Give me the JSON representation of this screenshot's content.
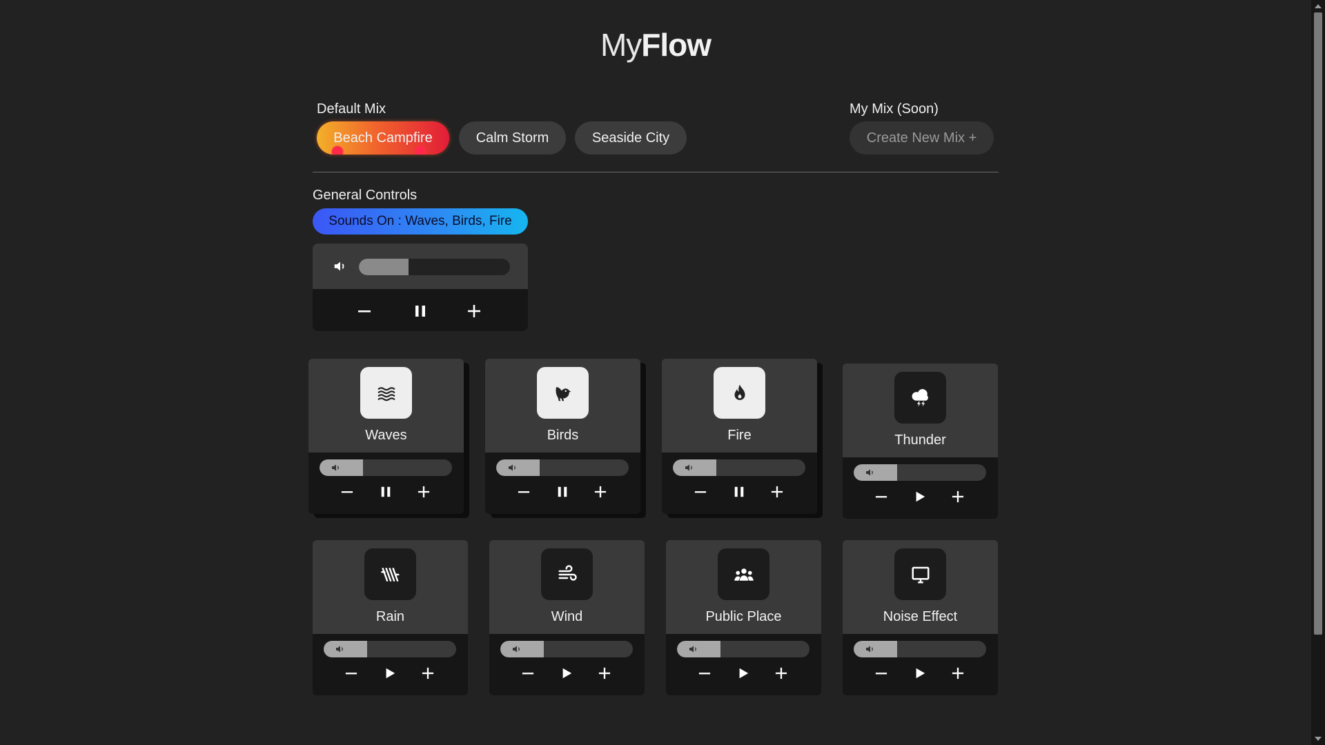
{
  "brand": {
    "light": "My",
    "bold": "Flow"
  },
  "default_mix": {
    "label": "Default Mix",
    "options": [
      {
        "label": "Beach Campfire",
        "active": true
      },
      {
        "label": "Calm Storm",
        "active": false
      },
      {
        "label": "Seaside City",
        "active": false
      }
    ]
  },
  "my_mix": {
    "label": "My Mix (Soon)",
    "create_label": "Create New Mix +"
  },
  "general_controls": {
    "label": "General Controls",
    "sounds_on": "Sounds On : Waves, Birds, Fire",
    "volume_fraction": 0.33,
    "playback_state": "pause",
    "icons": [
      "volume-icon",
      "minus-icon",
      "pause-icon",
      "plus-icon"
    ]
  },
  "sounds": [
    {
      "name": "Waves",
      "icon": "waves-icon",
      "active": true,
      "volume_fraction": 0.33,
      "control": "pause"
    },
    {
      "name": "Birds",
      "icon": "bird-icon",
      "active": true,
      "volume_fraction": 0.33,
      "control": "pause"
    },
    {
      "name": "Fire",
      "icon": "fire-icon",
      "active": true,
      "volume_fraction": 0.33,
      "control": "pause"
    },
    {
      "name": "Thunder",
      "icon": "thunder-cloud-icon",
      "active": false,
      "volume_fraction": 0.33,
      "control": "play"
    },
    {
      "name": "Rain",
      "icon": "rain-icon",
      "active": false,
      "volume_fraction": 0.33,
      "control": "play"
    },
    {
      "name": "Wind",
      "icon": "wind-icon",
      "active": false,
      "volume_fraction": 0.33,
      "control": "play"
    },
    {
      "name": "Public Place",
      "icon": "people-icon",
      "active": false,
      "volume_fraction": 0.33,
      "control": "play"
    },
    {
      "name": "Noise Effect",
      "icon": "monitor-icon",
      "active": false,
      "volume_fraction": 0.33,
      "control": "play"
    }
  ],
  "colors": {
    "background": "#222222",
    "card_top": "#3a3a3a",
    "card_bottom": "#161616",
    "sounds_on_start": "#3b57f5",
    "sounds_on_end": "#16b6f0",
    "campfire_start": "#f2b02a",
    "campfire_end": "#e21d38"
  }
}
